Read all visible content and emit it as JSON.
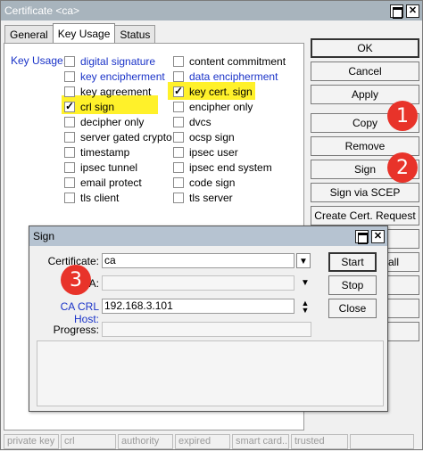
{
  "window": {
    "title": "Certificate <ca>"
  },
  "tabs": [
    {
      "label": "General",
      "active": false
    },
    {
      "label": "Key Usage",
      "active": true
    },
    {
      "label": "Status",
      "active": false
    }
  ],
  "key_usage": {
    "label": "Key Usage:",
    "left": [
      {
        "label": "digital signature",
        "checked": false,
        "blue": true
      },
      {
        "label": "key encipherment",
        "checked": false,
        "blue": true
      },
      {
        "label": "key agreement",
        "checked": false,
        "blue": false
      },
      {
        "label": "crl sign",
        "checked": true,
        "blue": false
      },
      {
        "label": "decipher only",
        "checked": false,
        "blue": false
      },
      {
        "label": "server gated crypto",
        "checked": false,
        "blue": false
      },
      {
        "label": "timestamp",
        "checked": false,
        "blue": false
      },
      {
        "label": "ipsec tunnel",
        "checked": false,
        "blue": false
      },
      {
        "label": "email protect",
        "checked": false,
        "blue": false
      },
      {
        "label": "tls client",
        "checked": false,
        "blue": false
      }
    ],
    "right": [
      {
        "label": "content commitment",
        "checked": false,
        "blue": false
      },
      {
        "label": "data encipherment",
        "checked": false,
        "blue": true
      },
      {
        "label": "key cert. sign",
        "checked": true,
        "blue": false
      },
      {
        "label": "encipher only",
        "checked": false,
        "blue": false
      },
      {
        "label": "dvcs",
        "checked": false,
        "blue": false
      },
      {
        "label": "ocsp sign",
        "checked": false,
        "blue": false
      },
      {
        "label": "ipsec user",
        "checked": false,
        "blue": false
      },
      {
        "label": "ipsec end system",
        "checked": false,
        "blue": false
      },
      {
        "label": "code sign",
        "checked": false,
        "blue": false
      },
      {
        "label": "tls server",
        "checked": false,
        "blue": false
      }
    ]
  },
  "buttons": {
    "ok": "OK",
    "cancel": "Cancel",
    "apply": "Apply",
    "copy": "Copy",
    "remove": "Remove",
    "sign": "Sign",
    "sign_via_scep": "Sign via SCEP",
    "create_cert_request": "Create Cert. Request",
    "partial_all": "all"
  },
  "status_bar": [
    "private key",
    "crl",
    "authority",
    "expired",
    "smart card...",
    "trusted",
    ""
  ],
  "sign_dialog": {
    "title": "Sign",
    "certificate_label": "Certificate:",
    "certificate_value": "ca",
    "ca_label_partial": "A:",
    "ca_value": "",
    "crl_host_label": "CA CRL Host:",
    "crl_host_value": "192.168.3.101",
    "progress_label": "Progress:",
    "progress_value": "",
    "start": "Start",
    "stop": "Stop",
    "close": "Close"
  },
  "markers": [
    "1",
    "2",
    "3"
  ],
  "colors": {
    "label_blue": "#1a33c8",
    "highlight": "#fff12a",
    "marker_red": "#e8332a",
    "titlebar": "#a8b4bd"
  }
}
